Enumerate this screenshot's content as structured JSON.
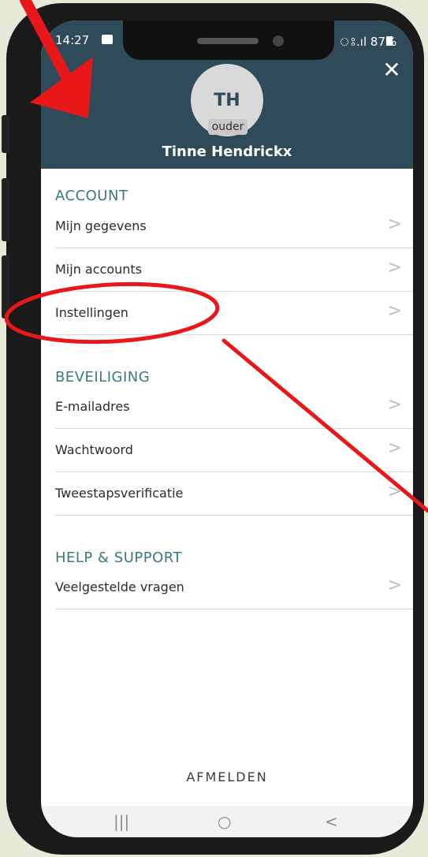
{
  "statusbar": {
    "time": "14:27",
    "signal": "ঃ.ıl 87%"
  },
  "header": {
    "close_icon": "close-icon",
    "initials": "TH",
    "role": "ouder",
    "name": "Tinne Hendrickx"
  },
  "sections": [
    {
      "title": "ACCOUNT",
      "items": [
        {
          "label": "Mijn gegevens"
        },
        {
          "label": "Mijn accounts"
        },
        {
          "label": "Instellingen"
        }
      ]
    },
    {
      "title": "BEVEILIGING",
      "items": [
        {
          "label": "E-mailadres"
        },
        {
          "label": "Wachtwoord"
        },
        {
          "label": "Tweestapsverificatie"
        }
      ]
    },
    {
      "title": "HELP & SUPPORT",
      "items": [
        {
          "label": "Veelgestelde vragen"
        }
      ]
    }
  ],
  "logout_label": "AFMELDEN",
  "chevron": ">",
  "navbar": {
    "recent": "|||",
    "home": "○",
    "back": "<"
  },
  "colors": {
    "header": "#2f4a59",
    "section": "#3a7a7a",
    "annotation": "#e8171a"
  }
}
